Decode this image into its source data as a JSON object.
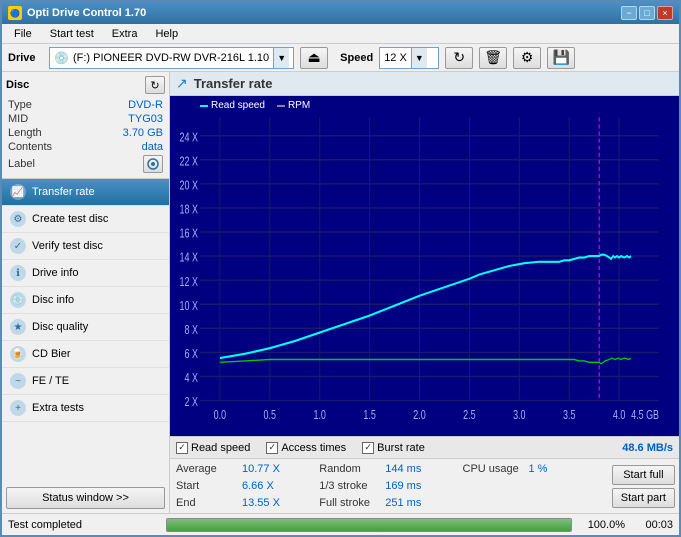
{
  "window": {
    "title": "Opti Drive Control 1.70",
    "controls": {
      "minimize": "−",
      "maximize": "□",
      "close": "×"
    }
  },
  "menu": {
    "items": [
      "File",
      "Start test",
      "Extra",
      "Help"
    ]
  },
  "drive": {
    "label": "Drive",
    "selected": "(F:)  PIONEER DVD-RW  DVR-216L 1.10",
    "speed_label": "Speed",
    "speed": "12 X"
  },
  "disc": {
    "title": "Disc",
    "type_key": "Type",
    "type_val": "DVD-R",
    "mid_key": "MID",
    "mid_val": "TYG03",
    "length_key": "Length",
    "length_val": "3.70 GB",
    "contents_key": "Contents",
    "contents_val": "data",
    "label_key": "Label"
  },
  "nav": {
    "items": [
      {
        "id": "transfer-rate",
        "label": "Transfer rate",
        "active": true
      },
      {
        "id": "create-test-disc",
        "label": "Create test disc",
        "active": false
      },
      {
        "id": "verify-test-disc",
        "label": "Verify test disc",
        "active": false
      },
      {
        "id": "drive-info",
        "label": "Drive info",
        "active": false
      },
      {
        "id": "disc-info",
        "label": "Disc info",
        "active": false
      },
      {
        "id": "disc-quality",
        "label": "Disc quality",
        "active": false
      },
      {
        "id": "cd-bier",
        "label": "CD Bier",
        "active": false
      },
      {
        "id": "fe-te",
        "label": "FE / TE",
        "active": false
      },
      {
        "id": "extra-tests",
        "label": "Extra tests",
        "active": false
      }
    ],
    "status_btn": "Status window >>"
  },
  "chart": {
    "title": "Transfer rate",
    "legend": {
      "read_speed": "Read speed",
      "rpm": "RPM"
    },
    "y_labels": [
      "24 X",
      "22 X",
      "20 X",
      "18 X",
      "16 X",
      "14 X",
      "12 X",
      "10 X",
      "8 X",
      "6 X",
      "4 X",
      "2 X"
    ],
    "x_labels": [
      "0.0",
      "0.5",
      "1.0",
      "1.5",
      "2.0",
      "2.5",
      "3.0",
      "3.5",
      "4.0",
      "4.5 GB"
    ]
  },
  "checkboxes": {
    "read_speed": "Read speed",
    "access_times": "Access times",
    "burst_rate": "Burst rate",
    "burst_value": "48.6 MB/s"
  },
  "stats": {
    "average_key": "Average",
    "average_val": "10.77 X",
    "start_key": "Start",
    "start_val": "6.66 X",
    "end_key": "End",
    "end_val": "13.55 X",
    "random_key": "Random",
    "random_val": "144 ms",
    "stroke_1_3_key": "1/3 stroke",
    "stroke_1_3_val": "169 ms",
    "full_stroke_key": "Full stroke",
    "full_stroke_val": "251 ms",
    "cpu_key": "CPU usage",
    "cpu_val": "1 %"
  },
  "buttons": {
    "start_full": "Start full",
    "start_part": "Start part"
  },
  "status_bar": {
    "text": "Test completed",
    "progress": "100.0%",
    "time": "00:03",
    "progress_pct": 100
  }
}
